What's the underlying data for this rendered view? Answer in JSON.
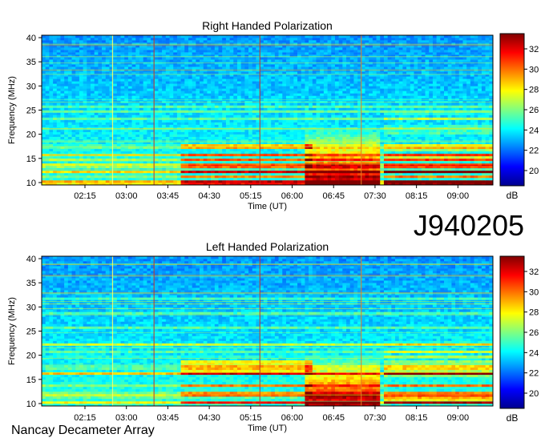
{
  "observation_id": "J940205",
  "instrument": "Nancay Decameter Array",
  "colors": {
    "colormap": [
      "#00008f",
      "#0000ff",
      "#0080ff",
      "#00ffff",
      "#80ff80",
      "#ffff00",
      "#ff8000",
      "#ff0000",
      "#800000"
    ]
  },
  "chart_data": [
    {
      "type": "heatmap",
      "title": "Right Handed Polarization",
      "xlabel": "Time (UT)",
      "ylabel": "Frequency (MHz)",
      "x_ticks": [
        "02:15",
        "03:00",
        "03:45",
        "04:30",
        "05:15",
        "06:00",
        "06:45",
        "07:30",
        "08:15",
        "09:00"
      ],
      "x_tick_minutes": [
        135,
        180,
        225,
        270,
        315,
        360,
        405,
        450,
        495,
        540
      ],
      "xlim_minutes": [
        88,
        578
      ],
      "y_ticks": [
        10,
        15,
        20,
        25,
        30,
        35,
        40
      ],
      "ylim": [
        9.5,
        40.5
      ],
      "colorbar": {
        "label": "dB",
        "ticks": [
          20,
          22,
          24,
          26,
          28,
          30,
          32
        ],
        "range": [
          18.5,
          33.5
        ]
      }
    },
    {
      "type": "heatmap",
      "title": "Left Handed Polarization",
      "xlabel": "Time (UT)",
      "ylabel": "Frequency (MHz)",
      "x_ticks": [
        "02:15",
        "03:00",
        "03:45",
        "04:30",
        "05:15",
        "06:00",
        "06:45",
        "07:30",
        "08:15",
        "09:00"
      ],
      "x_tick_minutes": [
        135,
        180,
        225,
        270,
        315,
        360,
        405,
        450,
        495,
        540
      ],
      "xlim_minutes": [
        88,
        578
      ],
      "y_ticks": [
        10,
        15,
        20,
        25,
        30,
        35,
        40
      ],
      "ylim": [
        9.5,
        40.5
      ],
      "colorbar": {
        "label": "dB",
        "ticks": [
          20,
          22,
          24,
          26,
          28,
          30,
          32
        ],
        "range": [
          18.5,
          33.5
        ]
      }
    }
  ]
}
